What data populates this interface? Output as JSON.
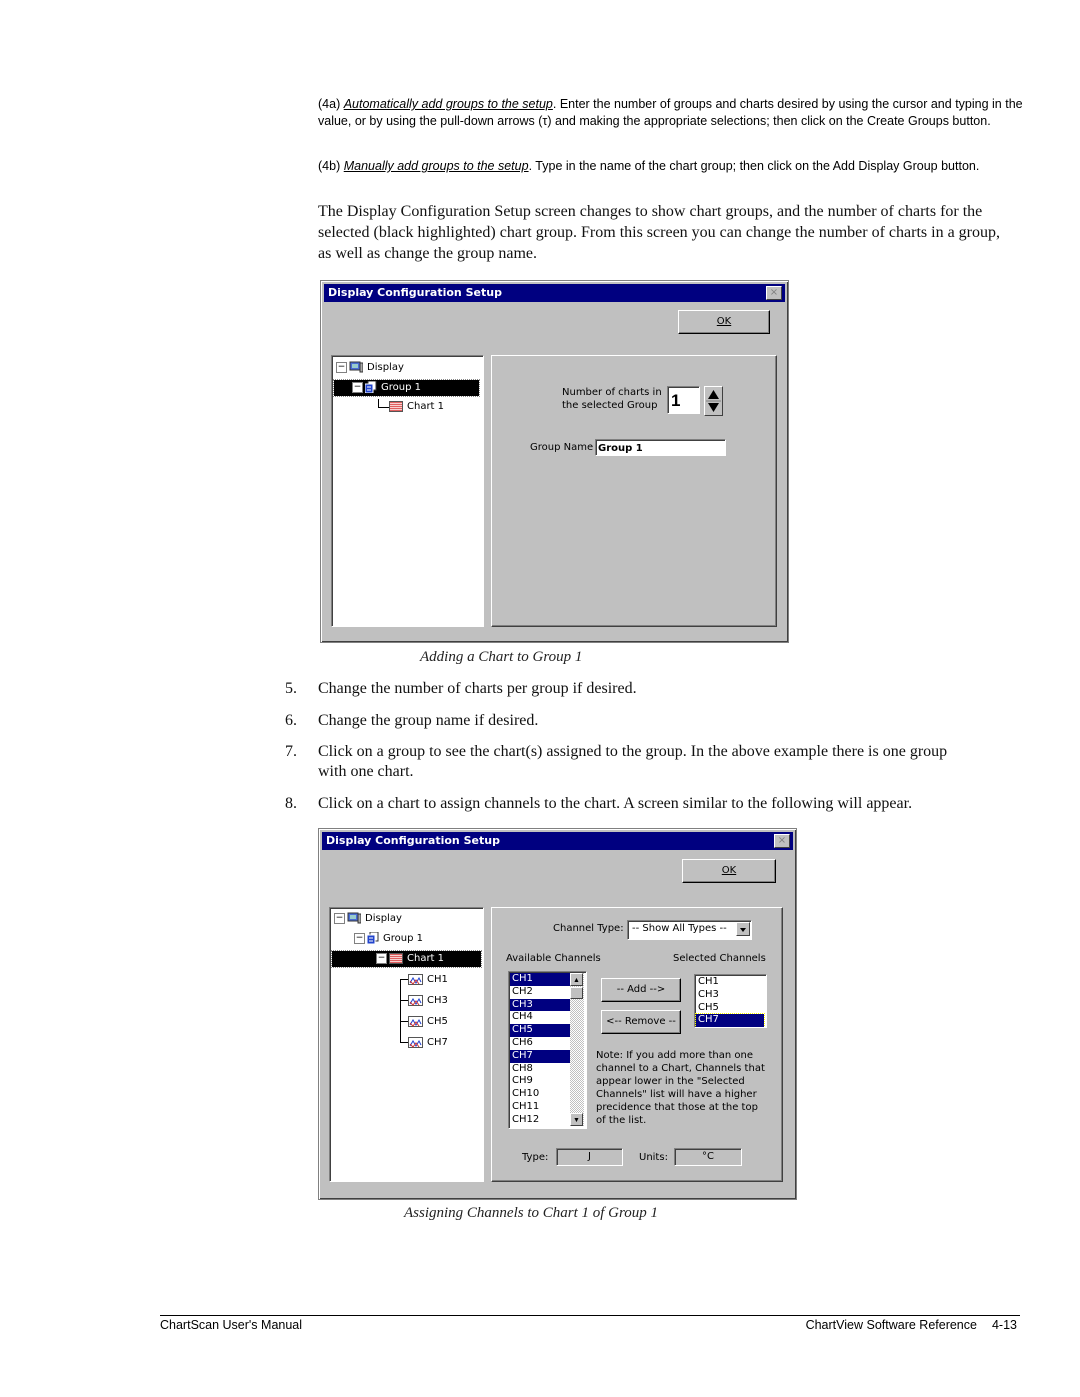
{
  "intro": {
    "p4a_label": "(4a)",
    "p4a_link": "Automatically add groups to the setup",
    "p4a_text": ".  Enter the number of groups and charts desired by using the cursor and typing in the value, or by using the pull-down arrows (τ) and making the appropriate selections; then click on the Create Groups button.",
    "p4b_label": "(4b)",
    "p4b_link": "Manually add groups to the setup",
    "p4b_text": ".  Type in the name of the chart group; then click on the Add Display Group button.",
    "body": "The Display Configuration Setup screen changes to show chart groups, and the number of charts for the selected (black highlighted) chart group.  From this screen you can change the number of charts in a group, as well as change the group name."
  },
  "dialog1": {
    "title": "Display Configuration  Setup",
    "close_glyph": "×",
    "ok_label": "OK",
    "tree": [
      {
        "label": "Display",
        "icon": "display-icon"
      },
      {
        "label": "Group 1",
        "icon": "group-icon",
        "selected": true
      },
      {
        "label": "Chart 1",
        "icon": "chart-icon"
      }
    ],
    "charts_label_line1": "Number of charts in",
    "charts_label_line2": "the selected Group",
    "charts_value": "1",
    "group_name_label": "Group Name",
    "group_name_value": "Group 1",
    "caption": "Adding a Chart to Group 1"
  },
  "steps": [
    {
      "num": "5.",
      "text": "Change the number of charts per group if desired."
    },
    {
      "num": "6.",
      "text": "Change the group name if desired."
    },
    {
      "num": "7.",
      "text": "Click on a group to see the chart(s) assigned to the group.  In the above example there is one group",
      "text2": "with one chart."
    },
    {
      "num": "8.",
      "text": "Click on a chart to assign channels to the chart.   A screen similar to the following will appear."
    }
  ],
  "dialog2": {
    "title": "Display Configuration  Setup",
    "close_glyph": "×",
    "ok_label": "OK",
    "tree": [
      {
        "label": "Display",
        "icon": "display-icon"
      },
      {
        "label": "Group 1",
        "icon": "group-icon"
      },
      {
        "label": "Chart 1",
        "icon": "chart-icon",
        "selected": true
      },
      {
        "label": "CH1",
        "icon": "channel-icon"
      },
      {
        "label": "CH3",
        "icon": "channel-icon"
      },
      {
        "label": "CH5",
        "icon": "channel-icon"
      },
      {
        "label": "CH7",
        "icon": "channel-icon"
      }
    ],
    "channel_type_label": "Channel Type:",
    "channel_type_value": "-- Show All Types --",
    "available_label": "Available Channels",
    "selected_label": "Selected Channels",
    "available": [
      {
        "label": "CH1",
        "selected": true
      },
      {
        "label": "CH2",
        "selected": false
      },
      {
        "label": "CH3",
        "selected": true
      },
      {
        "label": "CH4",
        "selected": false
      },
      {
        "label": "CH5",
        "selected": true
      },
      {
        "label": "CH6",
        "selected": false
      },
      {
        "label": "CH7",
        "selected": true
      },
      {
        "label": "CH8",
        "selected": false
      },
      {
        "label": "CH9",
        "selected": false
      },
      {
        "label": "CH10",
        "selected": false
      },
      {
        "label": "CH11",
        "selected": false
      },
      {
        "label": "CH12",
        "selected": false
      }
    ],
    "selected_channels": [
      {
        "label": "CH1",
        "selected": false
      },
      {
        "label": "CH3",
        "selected": false
      },
      {
        "label": "CH5",
        "selected": false
      },
      {
        "label": "CH7",
        "selected": true
      }
    ],
    "add_label": "-- Add -->",
    "remove_label": "<-- Remove --",
    "note": "Note:  If you add more than one channel to a Chart, Channels that appear lower in the \"Selected Channels\" list will have a higher precidence that those at the top of the list.",
    "type_label": "Type:",
    "type_value": "J",
    "units_label": "Units:",
    "units_value": "°C",
    "caption": "Assigning Channels to Chart 1 of Group 1"
  },
  "footer": {
    "left": "ChartScan User's Manual",
    "right": "ChartView Software Reference",
    "page": "4-13"
  },
  "colors": {
    "titlebar": "#000080",
    "dialog_bg": "#c0c0c0",
    "selection": "#000080"
  }
}
